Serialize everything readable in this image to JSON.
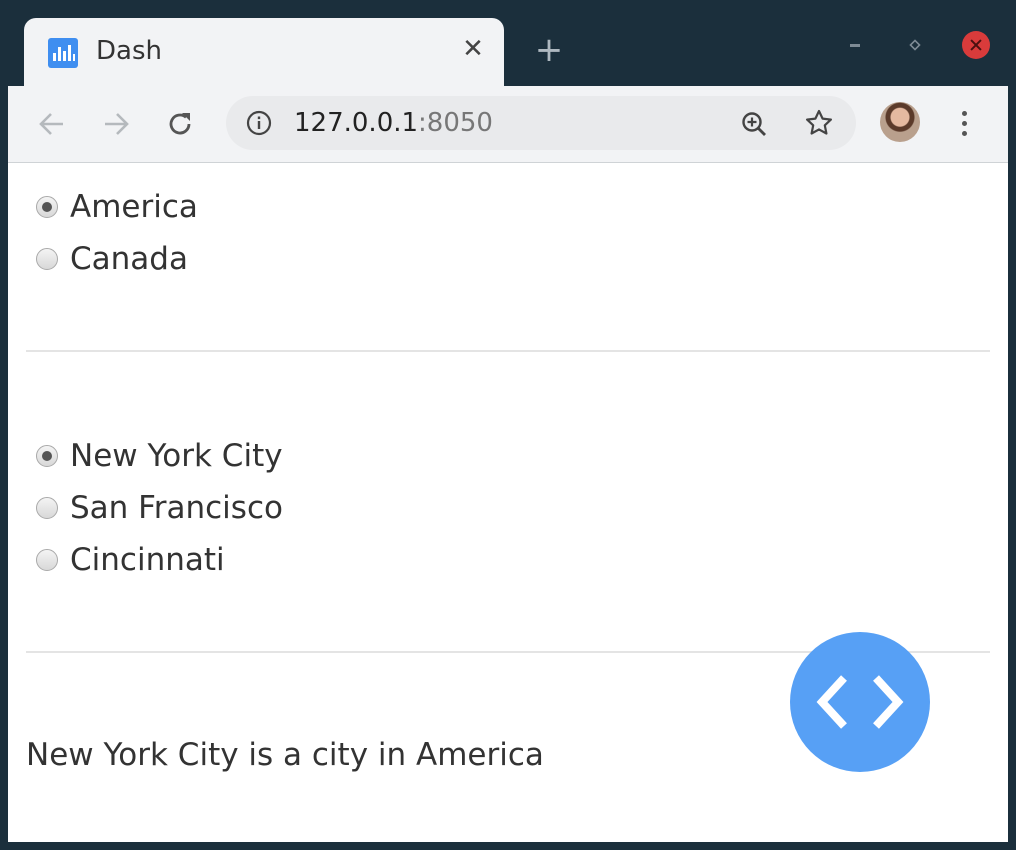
{
  "browser": {
    "tab_title": "Dash",
    "tab_close": "✕",
    "new_tab": "+",
    "url_host": "127.0.0.1",
    "url_port": ":8050"
  },
  "country_radio": {
    "options": [
      "America",
      "Canada"
    ],
    "selected": "America"
  },
  "city_radio": {
    "options": [
      "New York City",
      "San Francisco",
      "Cincinnati"
    ],
    "selected": "New York City"
  },
  "output_text": "New York City is a city in America",
  "icons": {
    "back": "arrow-left-icon",
    "forward": "arrow-right-icon",
    "reload": "reload-icon",
    "info": "info-icon",
    "zoom": "zoom-in-icon",
    "bookmark": "star-icon",
    "menu": "kebab-menu-icon",
    "devtools": "code-brackets-icon"
  },
  "colors": {
    "titlebar": "#1b2f3c",
    "favicon": "#3f8ef0",
    "fab": "#57a0f5",
    "close_button": "#d93b3b"
  }
}
